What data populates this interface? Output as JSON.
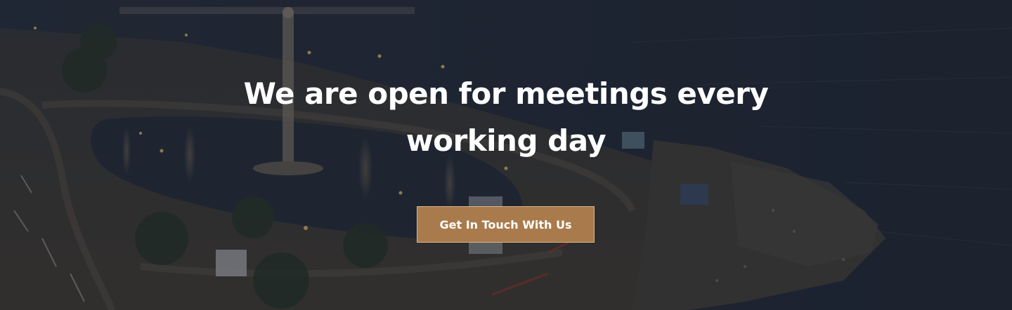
{
  "hero": {
    "title": "We are open for meetings every working day",
    "cta_label": "Get In Touch With Us"
  },
  "colors": {
    "accent": "#a97b4c",
    "overlay": "#141822",
    "text": "#ffffff"
  },
  "icons": {
    "background": "coastal-city-night-photo"
  }
}
